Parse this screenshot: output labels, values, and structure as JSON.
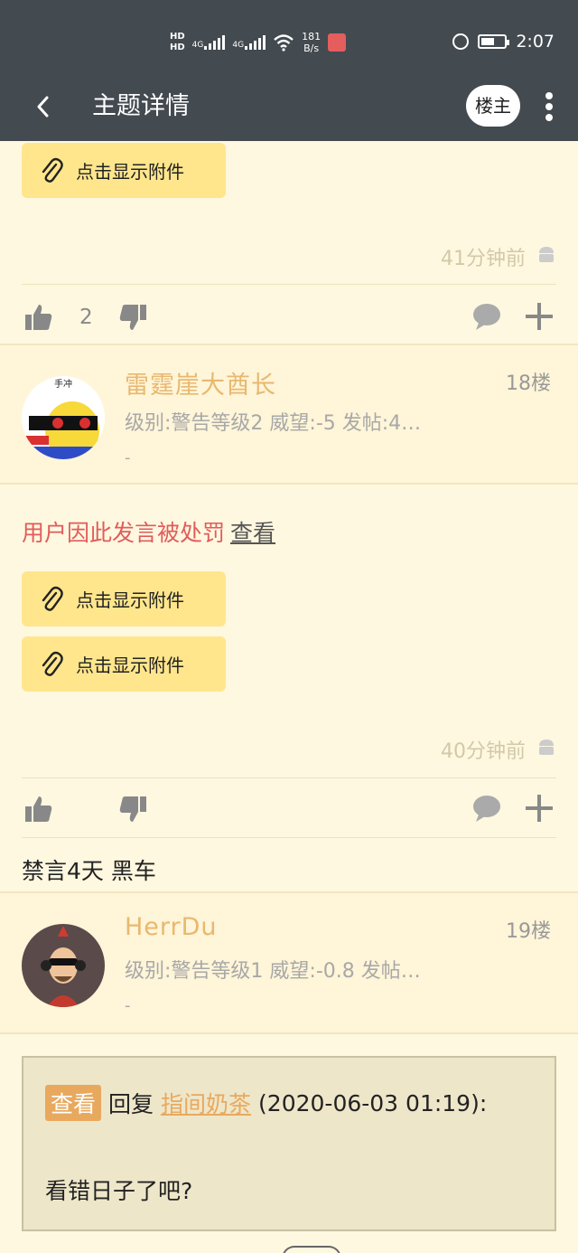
{
  "status_bar": {
    "hd1": "HD",
    "hd2": "HD",
    "net1": "4G",
    "net2": "4G",
    "speed": "181",
    "speed_unit": "B/s",
    "time": "2:07"
  },
  "toolbar": {
    "title": "主题详情",
    "louzhu": "楼主",
    "back_icon": "chevron-left-icon",
    "more_icon": "kebab-icon"
  },
  "colors": {
    "toolbar_bg": "#434a50",
    "page_bg": "#fff8e0",
    "attachment_bg": "#ffe68c",
    "username": "#e8b870",
    "penalty": "#e05c5c",
    "quote_tag": "#e8a95e"
  },
  "post17": {
    "attachments": [
      "点击显示附件"
    ],
    "time": "41分钟前",
    "like_count": "2"
  },
  "post18": {
    "username": "雷霆崖大酋长",
    "floor": "18楼",
    "meta": "级别:警告等级2   威望:-5   发帖:4…",
    "dash": "-",
    "penalty_text": "用户因此发言被处罚",
    "penalty_link": "查看",
    "attachments": [
      "点击显示附件",
      "点击显示附件"
    ],
    "time": "40分钟前",
    "ban_note": "禁言4天 黑车"
  },
  "post19": {
    "username": "HerrDu",
    "floor": "19楼",
    "meta": "级别:警告等级1   威望:-0.8   发帖…",
    "dash": "-",
    "quote_tag": "查看",
    "quote_reply": "回复",
    "quote_user": "指间奶茶",
    "quote_time": "(2020-06-03 01:19):",
    "body": "看错日子了吧?"
  }
}
